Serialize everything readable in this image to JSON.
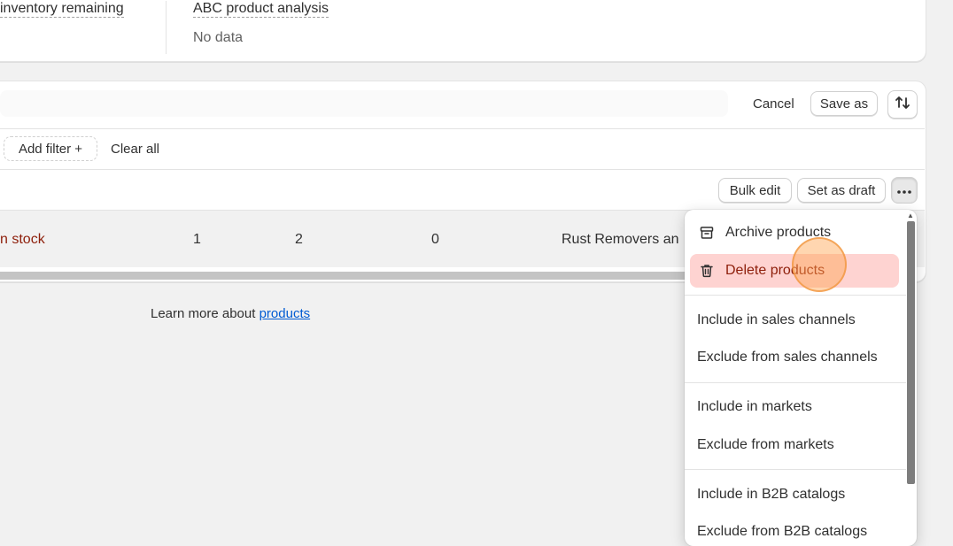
{
  "analytics": {
    "metric_1_title": "inventory remaining",
    "metric_2_title": "ABC product analysis",
    "metric_2_value": "No data"
  },
  "toolbar": {
    "cancel_label": "Cancel",
    "save_as_label": "Save as",
    "sort_icon": "sort-arrows-icon"
  },
  "filters": {
    "add_filter_label": "Add filter +",
    "clear_all_label": "Clear all"
  },
  "bulk_actions": {
    "bulk_edit_label": "Bulk edit",
    "set_as_draft_label": "Set as draft",
    "more_icon": "more-horizontal-icon"
  },
  "row": {
    "status": "n stock",
    "col_1": "1",
    "col_2": "2",
    "col_3": "0",
    "category": "Rust Removers an"
  },
  "footer": {
    "prefix": "Learn more about ",
    "link": "products"
  },
  "menu": {
    "archive": "Archive products",
    "delete": "Delete products",
    "include_sales": "Include in sales channels",
    "exclude_sales": "Exclude from sales channels",
    "include_markets": "Include in markets",
    "exclude_markets": "Exclude from markets",
    "include_b2b": "Include in B2B catalogs",
    "exclude_b2b": "Exclude from B2B catalogs"
  },
  "colors": {
    "status_text": "#8e1f0b",
    "danger_bg": "#fed3d1",
    "link": "#005bd3"
  }
}
